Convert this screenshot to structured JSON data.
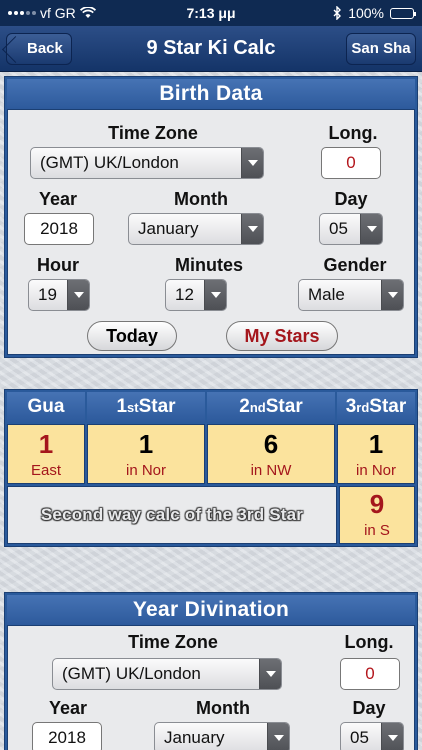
{
  "status": {
    "carrier": "vf GR",
    "time": "7:13 μμ",
    "battery": "100%"
  },
  "nav": {
    "back_label": "Back",
    "title": "9 Star Ki Calc",
    "right_label": "San Sha"
  },
  "birth": {
    "title": "Birth Data",
    "timezone_label": "Time Zone",
    "timezone_value": "(GMT) UK/London",
    "long_label": "Long.",
    "long_value": "0",
    "year_label": "Year",
    "year_value": "2018",
    "month_label": "Month",
    "month_value": "January",
    "day_label": "Day",
    "day_value": "05",
    "hour_label": "Hour",
    "hour_value": "19",
    "minutes_label": "Minutes",
    "minutes_value": "12",
    "gender_label": "Gender",
    "gender_value": "Male",
    "today_button": "Today",
    "mystars_button": "My Stars"
  },
  "stars": {
    "headers": {
      "gua": "Gua",
      "first_num": "1",
      "first_suffix": "st",
      "first_word": "Star",
      "second_num": "2",
      "second_suffix": "nd",
      "second_word": "Star",
      "third_num": "3",
      "third_suffix": "rd",
      "third_word": "Star"
    },
    "gua": {
      "num": "1",
      "dir": "East"
    },
    "first": {
      "num": "1",
      "dir": "in Nor"
    },
    "second": {
      "num": "6",
      "dir": "in NW"
    },
    "third": {
      "num": "1",
      "dir": "in Nor"
    },
    "second_way_label": "Second way calc of the 3rd Star",
    "second_way": {
      "num": "9",
      "dir": "in S"
    }
  },
  "year_div": {
    "title": "Year Divination",
    "timezone_label": "Time Zone",
    "timezone_value": "(GMT) UK/London",
    "long_label": "Long.",
    "long_value": "0",
    "year_label": "Year",
    "year_value": "2018",
    "month_label": "Month",
    "month_value": "January",
    "day_label": "Day",
    "day_value": "05"
  },
  "colors": {
    "navbar": "#143468",
    "panel_header": "#2d5a9c",
    "star_cell": "#fbe39d",
    "accent_red": "#a4161c"
  }
}
